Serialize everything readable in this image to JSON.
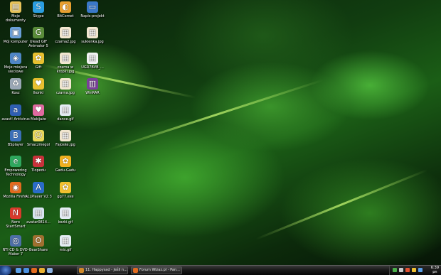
{
  "desktop": {
    "icons": [
      {
        "label": "Moje dokumenty",
        "icon": "folder-documents-icon",
        "color": "#e8c35a",
        "glyph": "▤"
      },
      {
        "label": "Mój komputer",
        "icon": "computer-icon",
        "color": "#6a9fd8",
        "glyph": "▣"
      },
      {
        "label": "Moje miejsca sieciowe",
        "icon": "network-places-icon",
        "color": "#4f86c6",
        "glyph": "◈"
      },
      {
        "label": "Kosz",
        "icon": "recycle-bin-icon",
        "color": "#9aa7b5",
        "glyph": "♻"
      },
      {
        "label": "avast! Antivirus",
        "icon": "avast-icon",
        "color": "#2f5fb3",
        "glyph": "a"
      },
      {
        "label": "BSplayer",
        "icon": "bsplayer-icon",
        "color": "#3b6fb8",
        "glyph": "B"
      },
      {
        "label": "Empowering Technology",
        "icon": "empowering-technology-icon",
        "color": "#2fa75e",
        "glyph": "e"
      },
      {
        "label": "Mozilla Firefox",
        "icon": "firefox-icon",
        "color": "#e26b1f",
        "glyph": "◉"
      },
      {
        "label": "Nero StartSmart",
        "icon": "nero-icon",
        "color": "#d83a2b",
        "glyph": "N"
      },
      {
        "label": "NTI CD & DVD-Maker 7",
        "icon": "nti-cd-dvd-icon",
        "color": "#4d6fa8",
        "glyph": "◎"
      },
      {
        "label": "Skype",
        "icon": "skype-icon",
        "color": "#2a9ee0",
        "glyph": "S"
      },
      {
        "label": "Ulead GIF Animator 5",
        "icon": "ulead-gif-icon",
        "color": "#5a8c3a",
        "glyph": "G"
      },
      {
        "label": "Gift",
        "icon": "gift-icon",
        "color": "#e8c030",
        "glyph": "✿"
      },
      {
        "label": "Ikonki",
        "icon": "heart-folder-icon",
        "color": "#e8c030",
        "glyph": "♥"
      },
      {
        "label": "Makijaże",
        "icon": "makeup-heart-icon",
        "color": "#e06aa0",
        "glyph": "♥"
      },
      {
        "label": "Smaczmegol",
        "icon": "smaczmegol-icon",
        "color": "#e8d85a",
        "glyph": "☺"
      },
      {
        "label": "Tlopedu",
        "icon": "tlopedu-icon",
        "color": "#c8323a",
        "glyph": "✱"
      },
      {
        "label": "ALLPlayer V2.3",
        "icon": "allplayer-icon",
        "color": "#2a6cc8",
        "glyph": "A"
      },
      {
        "label": "avatar0814...",
        "icon": "image-file-icon",
        "color": "#d8e4f0",
        "glyph": "▦"
      },
      {
        "label": "BearShare",
        "icon": "bearshare-icon",
        "color": "#a07030",
        "glyph": "ʘ"
      },
      {
        "label": "BitComet",
        "icon": "bitcomet-icon",
        "color": "#e8a030",
        "glyph": "◐"
      },
      {
        "label": "czarna2.jpg",
        "icon": "image-file-icon",
        "color": "#f2e7d0",
        "glyph": "▦"
      },
      {
        "label": "czarna w kropki.jpg",
        "icon": "image-file-icon",
        "color": "#f2e7d0",
        "glyph": "▦"
      },
      {
        "label": "czarna.jpg",
        "icon": "image-file-icon",
        "color": "#f2e7d0",
        "glyph": "▦"
      },
      {
        "label": "dance.gif",
        "icon": "image-file-icon",
        "color": "#e4ecf4",
        "glyph": "▦"
      },
      {
        "label": "Fajoske.jpg",
        "icon": "image-file-icon",
        "color": "#f2e7d0",
        "glyph": "▦"
      },
      {
        "label": "Gadu-Gadu",
        "icon": "gadu-gadu-icon",
        "color": "#f0b020",
        "glyph": "✿"
      },
      {
        "label": "gg77.exe",
        "icon": "exe-file-icon",
        "color": "#f0c030",
        "glyph": "✿"
      },
      {
        "label": "kozki.gif",
        "icon": "image-file-icon",
        "color": "#e4ecf4",
        "glyph": "▦"
      },
      {
        "label": "miś.gif",
        "icon": "image-file-icon",
        "color": "#e4ecf4",
        "glyph": "▦"
      },
      {
        "label": "Napis-projekt",
        "icon": "napis-projekt-icon",
        "color": "#3a78c8",
        "glyph": "▭"
      },
      {
        "label": "sukienka.jpg",
        "icon": "image-file-icon",
        "color": "#f2e7d0",
        "glyph": "▦"
      },
      {
        "label": "UGR7BVB_...",
        "icon": "image-file-icon",
        "color": "#f2f2f2",
        "glyph": "▦"
      },
      {
        "label": "WinRAR",
        "icon": "winrar-icon",
        "color": "#7a3f9a",
        "glyph": "▥"
      }
    ]
  },
  "taskbar": {
    "tasks": [
      {
        "label": "11. Happysad - Jeśli n...",
        "icon": "media-player-icon",
        "color": "#d08a2a"
      },
      {
        "label": "Forum Wizaz.pl - Pan...",
        "icon": "firefox-icon",
        "color": "#e26b1f"
      }
    ],
    "quick_launch": [
      {
        "icon": "show-desktop-icon",
        "color": "#5aa0e8"
      },
      {
        "icon": "ie-icon",
        "color": "#4a90e0"
      },
      {
        "icon": "firefox-icon",
        "color": "#e26b1f"
      },
      {
        "icon": "media-icon",
        "color": "#e8b030"
      },
      {
        "icon": "extra-icon",
        "color": "#8ab0e0"
      }
    ],
    "tray_icons": [
      {
        "icon": "network-icon",
        "color": "#4ab04a"
      },
      {
        "icon": "volume-icon",
        "color": "#cccccc"
      },
      {
        "icon": "antivirus-icon",
        "color": "#e05030"
      },
      {
        "icon": "gg-icon",
        "color": "#f0c030"
      },
      {
        "icon": "update-icon",
        "color": "#5aa0e8"
      }
    ],
    "clock": {
      "time": "6:39",
      "date": "pn"
    }
  },
  "colors": {
    "taskbar": "#1a1a1a",
    "label_text": "#ffffff"
  }
}
